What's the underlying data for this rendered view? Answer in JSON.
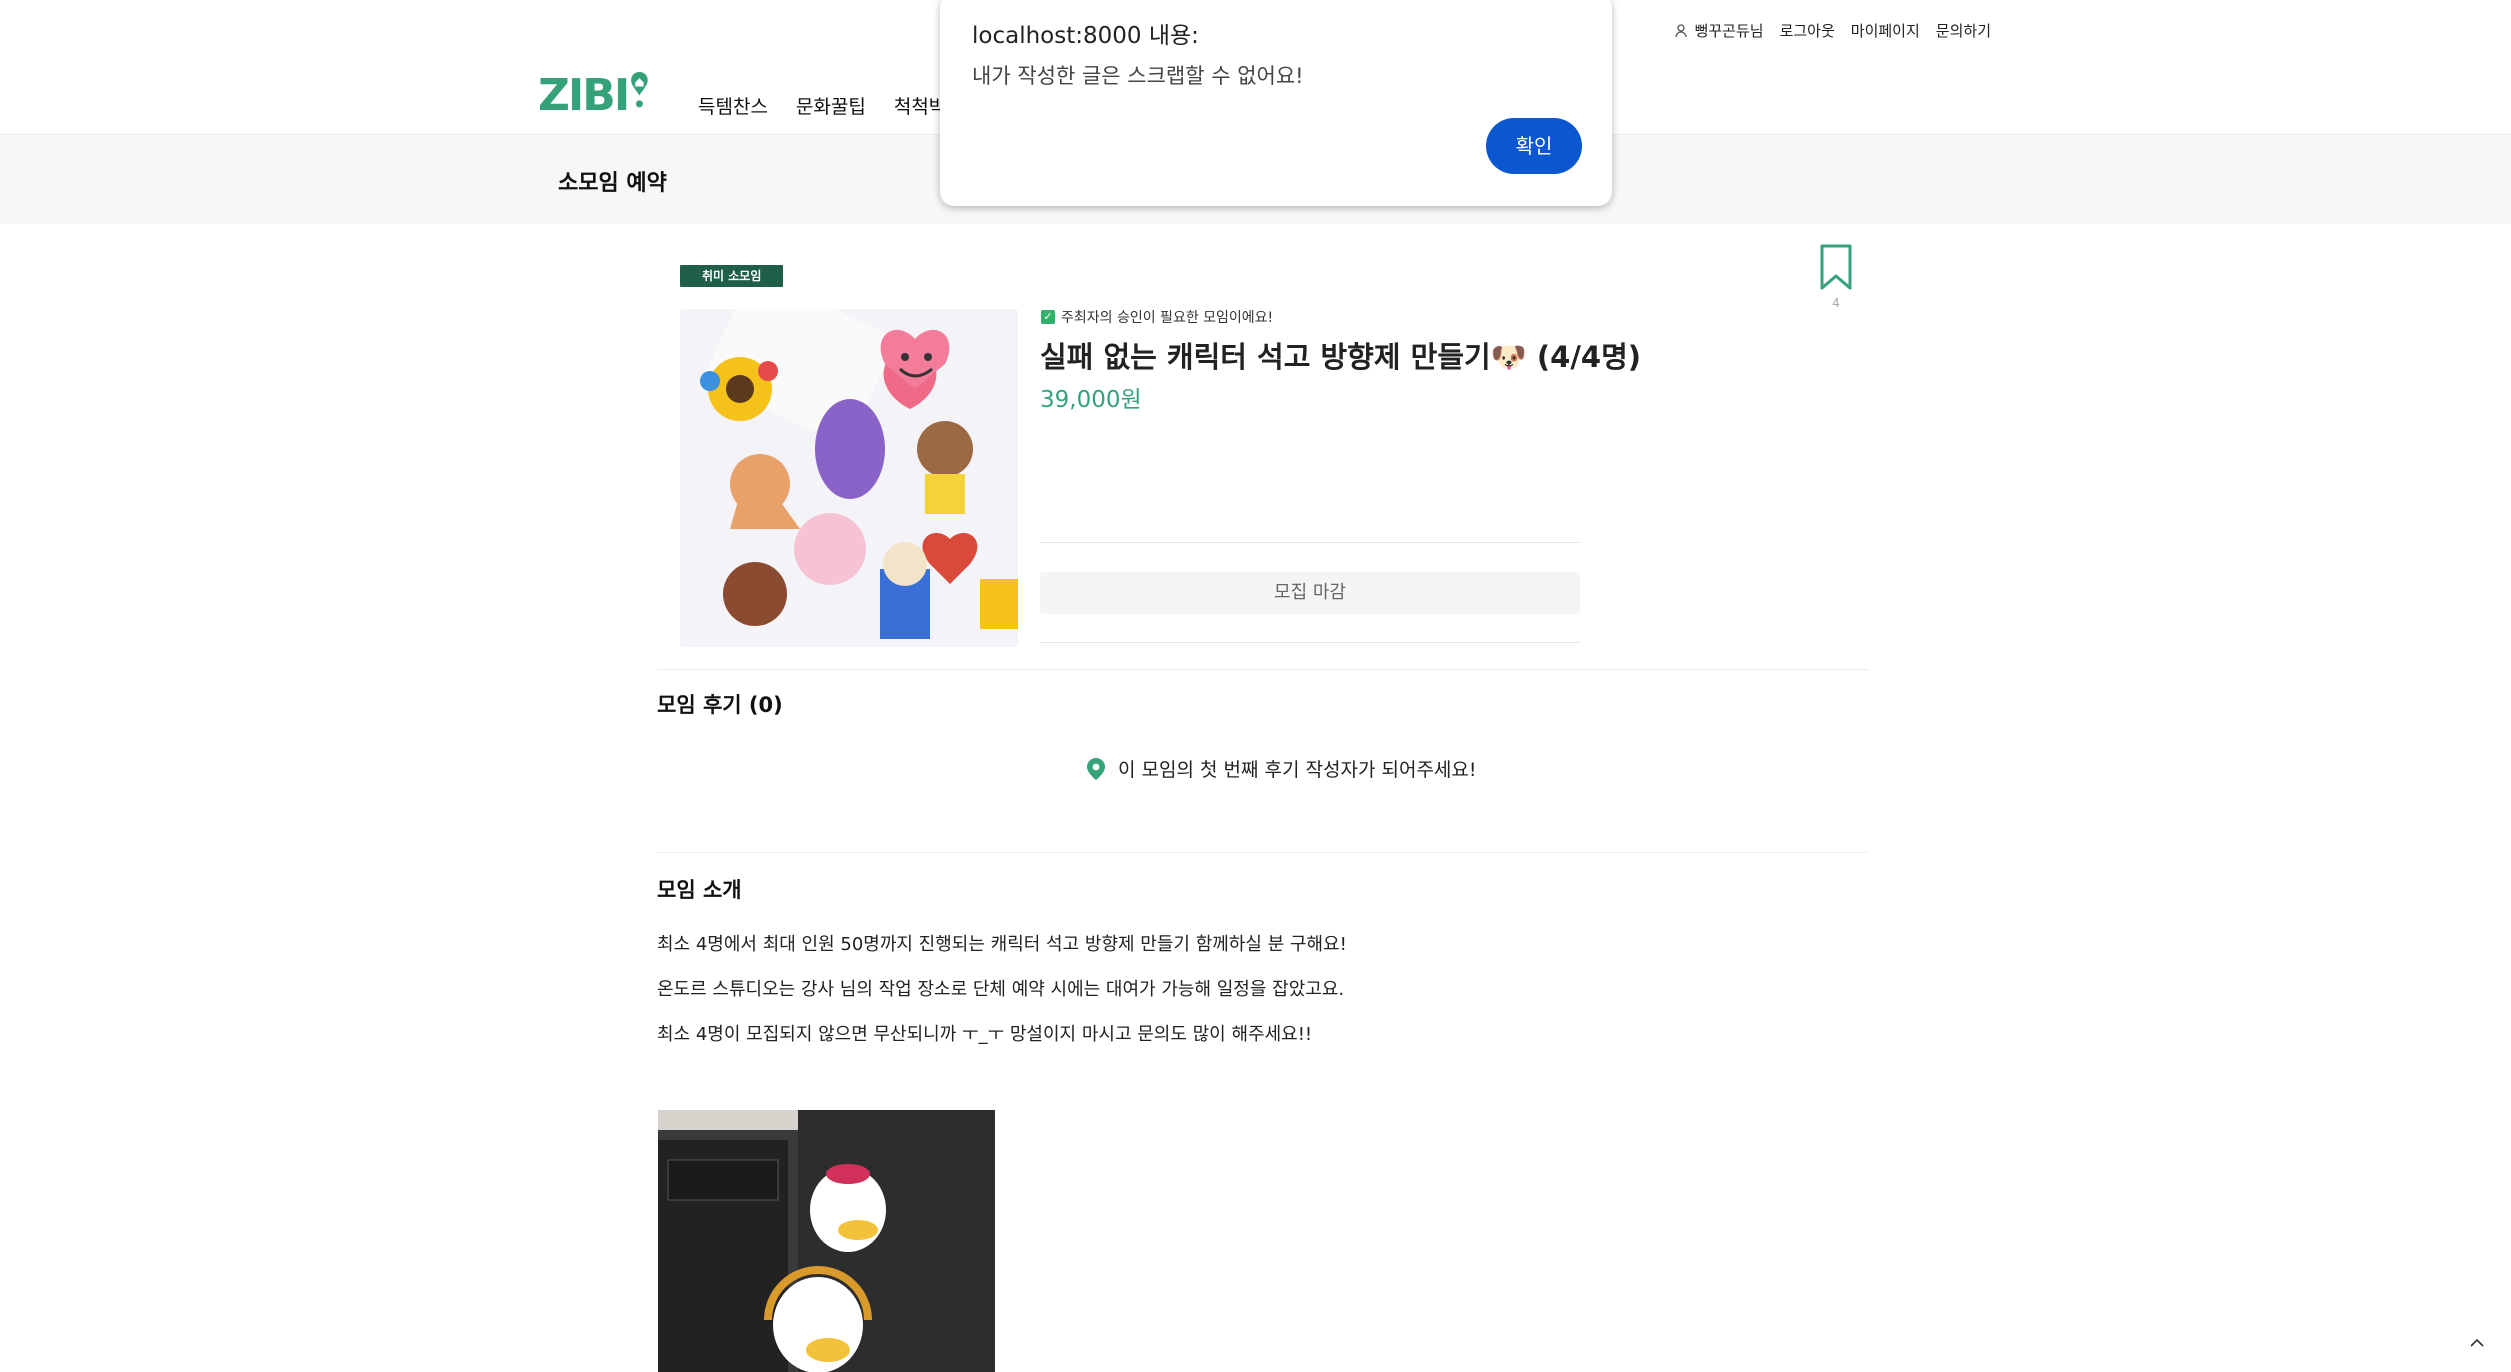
{
  "header": {
    "user_name": "뻥꾸곤듀님",
    "logout": "로그아웃",
    "mypage": "마이페이지",
    "inquiry": "문의하기",
    "logo_text": "ZIBI",
    "nav": [
      "득템찬스",
      "문화꿀팁",
      "척척박사"
    ]
  },
  "subbar": {
    "title": "소모임 예약"
  },
  "product": {
    "category": "취미 소모임",
    "approval_note": "주최자의 승인이 필요한 모임이에요!",
    "title": "실패 없는 캐릭터 석고 방향제 만들기",
    "emoji": "🐶",
    "capacity": "(4/4명)",
    "price": "39,000원",
    "status_button": "모집 마감",
    "bookmark_count": "4"
  },
  "reviews": {
    "heading": "모임 후기 (0)",
    "empty_message": "이 모임의 첫 번째 후기 작성자가 되어주세요!"
  },
  "intro": {
    "heading": "모임 소개",
    "lines": [
      "최소 4명에서 최대 인원 50명까지 진행되는 캐릭터 석고 방향제 만들기 함께하실 분 구해요!",
      "온도르 스튜디오는 강사 님의 작업 장소로 단체 예약 시에는 대여가 가능해 일정을 잡았고요.",
      "최소 4명이 모집되지 않으면 무산되니까 ㅜ_ㅜ 망설이지 마시고 문의도 많이 해주세요!!"
    ]
  },
  "dialog": {
    "title": "localhost:8000 내용:",
    "message": "내가 작성한 글은 스크랩할 수 없어요!",
    "confirm": "확인"
  },
  "colors": {
    "brand": "#35a27a",
    "badge": "#1f5e4a",
    "dialog_button": "#0b57d0"
  }
}
